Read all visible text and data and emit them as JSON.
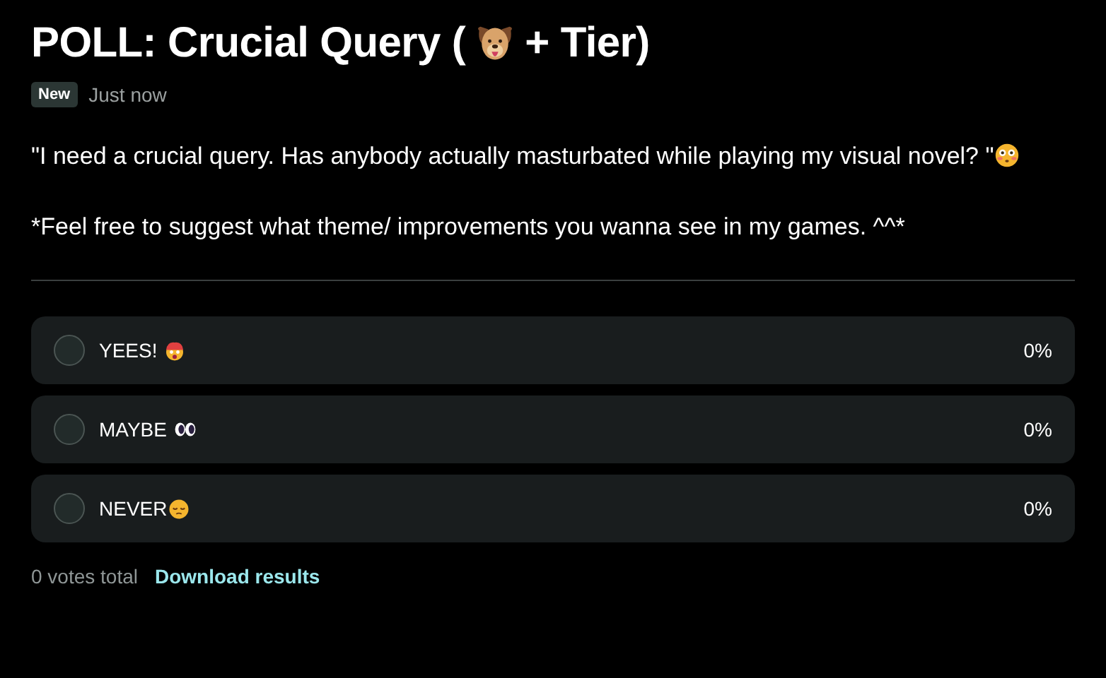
{
  "title": {
    "before": "POLL: Crucial Query (",
    "after": "+ Tier)"
  },
  "meta": {
    "badge": "New",
    "time": "Just now"
  },
  "body": {
    "question": "\"I need a crucial query. Has anybody actually masturbated while playing my visual novel? \"",
    "note": "*Feel free to suggest what theme/ improvements you wanna see in my games. ^^*"
  },
  "options": [
    {
      "label": "YEES!",
      "percent": "0%",
      "selected": false
    },
    {
      "label": "MAYBE",
      "percent": "0%",
      "selected": false
    },
    {
      "label": "NEVER",
      "percent": "0%",
      "selected": false
    }
  ],
  "footer": {
    "total": "0 votes total",
    "link": "Download results"
  }
}
